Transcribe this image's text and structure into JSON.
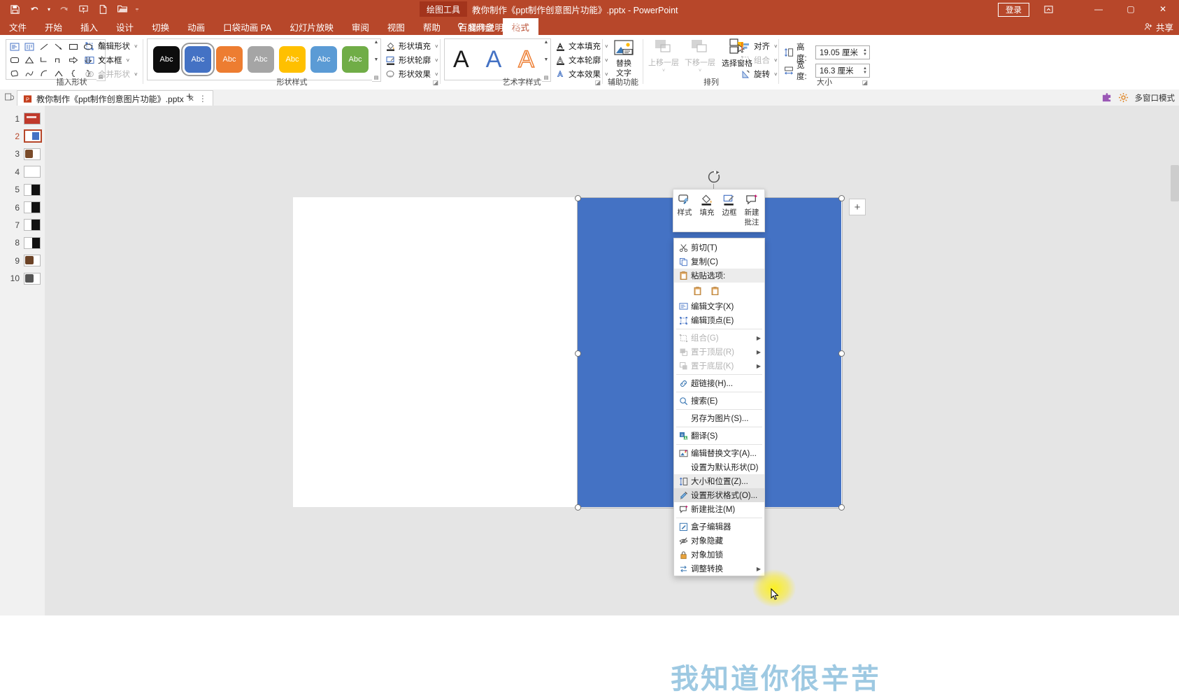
{
  "titlebar": {
    "context_tool": "绘图工具",
    "document_title": "教你制作《ppt制作创意图片功能》.pptx  -  PowerPoint",
    "signin": "登录",
    "minimize": "—",
    "maximize": "▢",
    "close": "✕",
    "qat": [
      "save-icon",
      "undo-icon",
      "redo-icon",
      "present-icon",
      "new-icon",
      "open-icon",
      "customize-qat-icon"
    ]
  },
  "tabs": {
    "items": [
      {
        "label": "文件",
        "active": false
      },
      {
        "label": "开始",
        "active": false
      },
      {
        "label": "插入",
        "active": false
      },
      {
        "label": "设计",
        "active": false
      },
      {
        "label": "切换",
        "active": false
      },
      {
        "label": "动画",
        "active": false
      },
      {
        "label": "口袋动画 PA",
        "active": false
      },
      {
        "label": "幻灯片放映",
        "active": false
      },
      {
        "label": "审阅",
        "active": false
      },
      {
        "label": "视图",
        "active": false
      },
      {
        "label": "帮助",
        "active": false
      },
      {
        "label": "百度网盘",
        "active": false
      },
      {
        "label": "格式",
        "active": true
      }
    ],
    "tellme": "操作说明搜索",
    "share": "共享"
  },
  "ribbon": {
    "groups": [
      {
        "label": "插入形状"
      },
      {
        "label": "形状样式"
      },
      {
        "label": "艺术字样式"
      },
      {
        "label": "辅助功能"
      },
      {
        "label": "排列"
      },
      {
        "label": "大小"
      }
    ],
    "shape_tools": [
      {
        "label": "编辑形状",
        "icon": "edit-shape-icon",
        "disabled": false,
        "caret": true
      },
      {
        "label": "文本框",
        "icon": "textbox-icon",
        "disabled": false,
        "caret": true
      },
      {
        "label": "合并形状",
        "icon": "merge-shapes-icon",
        "disabled": true,
        "caret": true
      }
    ],
    "shape_style_swatches": [
      {
        "color": "#0d0d0d",
        "label": "Abc",
        "selected": false
      },
      {
        "color": "#4472c4",
        "label": "Abc",
        "selected": true
      },
      {
        "color": "#ed7d31",
        "label": "Abc",
        "selected": false
      },
      {
        "color": "#a5a5a5",
        "label": "Abc",
        "selected": false
      },
      {
        "color": "#ffc000",
        "label": "Abc",
        "selected": false
      },
      {
        "color": "#5b9bd5",
        "label": "Abc",
        "selected": false
      },
      {
        "color": "#70ad47",
        "label": "Abc",
        "selected": false
      }
    ],
    "shape_format": [
      {
        "label": "形状填充",
        "icon": "shape-fill-icon"
      },
      {
        "label": "形状轮廓",
        "icon": "shape-outline-icon"
      },
      {
        "label": "形状效果",
        "icon": "shape-effects-icon"
      }
    ],
    "wordart_letters": [
      {
        "glyph": "A",
        "color": "#1a1a1a"
      },
      {
        "glyph": "A",
        "color": "#4472c4"
      },
      {
        "glyph": "A",
        "color": "#ed7d31"
      }
    ],
    "text_format": [
      {
        "label": "文本填充",
        "icon": "text-fill-icon"
      },
      {
        "label": "文本轮廓",
        "icon": "text-outline-icon"
      },
      {
        "label": "文本效果",
        "icon": "text-effects-icon"
      }
    ],
    "alt_text": "替换\n文字",
    "alt_text_line1": "替换",
    "alt_text_line2": "文字",
    "arrange": [
      {
        "label": "上移一层",
        "disabled": true,
        "caret": true
      },
      {
        "label": "下移一层",
        "disabled": true,
        "caret": true
      },
      {
        "label": "选择窗格",
        "disabled": false,
        "caret": false
      }
    ],
    "arrange_right": [
      {
        "label": "对齐",
        "icon": "align-icon",
        "disabled": false
      },
      {
        "label": "组合",
        "icon": "group-icon",
        "disabled": true
      },
      {
        "label": "旋转",
        "icon": "rotate-icon",
        "disabled": false
      }
    ],
    "size": {
      "height_label": "高度:",
      "height_value": "19.05 厘米",
      "width_label": "宽度:",
      "width_value": "16.3 厘米"
    }
  },
  "docbar": {
    "tab_title": "教你制作《ppt制作创意图片功能》.pptx",
    "tab_close": "✕",
    "tab_more": "⋮",
    "new_tab": "+",
    "multi_window": "多窗口模式"
  },
  "slides": {
    "items": [
      {
        "num": "1",
        "selected": false
      },
      {
        "num": "2",
        "selected": true
      },
      {
        "num": "3",
        "selected": false
      },
      {
        "num": "4",
        "selected": false
      },
      {
        "num": "5",
        "selected": false
      },
      {
        "num": "6",
        "selected": false
      },
      {
        "num": "7",
        "selected": false
      },
      {
        "num": "8",
        "selected": false
      },
      {
        "num": "9",
        "selected": false
      },
      {
        "num": "10",
        "selected": false
      }
    ]
  },
  "canvas": {
    "shape_color": "#4472c4",
    "bottom_text": "我知道你很辛苦",
    "add_button": "+"
  },
  "minibar": {
    "items": [
      {
        "label": "样式",
        "icon": "shape-style-icon",
        "caret": true
      },
      {
        "label": "填充",
        "icon": "fill-bucket-icon",
        "caret": true
      },
      {
        "label": "边框",
        "icon": "border-pen-icon",
        "caret": true
      },
      {
        "label": "新建\n批注",
        "line1": "新建",
        "line2": "批注",
        "icon": "new-comment-icon",
        "caret": false
      }
    ]
  },
  "context_menu": {
    "items": [
      {
        "label": "剪切(T)",
        "icon": "scissors-icon",
        "disabled": false,
        "arrow": false,
        "separator_after": false
      },
      {
        "label": "复制(C)",
        "icon": "copy-icon",
        "disabled": false,
        "arrow": false,
        "separator_after": false
      },
      {
        "label": "粘贴选项:",
        "icon": "paste-icon",
        "disabled": false,
        "arrow": false,
        "shaded": true,
        "separator_after": false
      },
      {
        "label": "编辑文字(X)",
        "icon": "edit-text-icon",
        "disabled": false,
        "arrow": false,
        "separator_after": false
      },
      {
        "label": "编辑顶点(E)",
        "icon": "edit-points-icon",
        "disabled": false,
        "arrow": false,
        "separator_after": true
      },
      {
        "label": "组合(G)",
        "icon": "group-icon",
        "disabled": true,
        "arrow": true,
        "separator_after": false
      },
      {
        "label": "置于顶层(R)",
        "icon": "bring-front-icon",
        "disabled": true,
        "arrow": true,
        "separator_after": false
      },
      {
        "label": "置于底层(K)",
        "icon": "send-back-icon",
        "disabled": true,
        "arrow": true,
        "separator_after": true
      },
      {
        "label": "超链接(H)...",
        "icon": "hyperlink-icon",
        "disabled": false,
        "arrow": false,
        "separator_after": true
      },
      {
        "label": "搜索(E)",
        "icon": "search-icon",
        "disabled": false,
        "arrow": false,
        "separator_after": true
      },
      {
        "label": "另存为图片(S)...",
        "icon": "",
        "disabled": false,
        "arrow": false,
        "separator_after": true
      },
      {
        "label": "翻译(S)",
        "icon": "translate-icon",
        "disabled": false,
        "arrow": false,
        "separator_after": true
      },
      {
        "label": "编辑替换文字(A)...",
        "icon": "alt-text-icon",
        "disabled": false,
        "arrow": false,
        "separator_after": false
      },
      {
        "label": "设置为默认形状(D)",
        "icon": "",
        "disabled": false,
        "arrow": false,
        "separator_after": false
      },
      {
        "label": "大小和位置(Z)...",
        "icon": "size-position-icon",
        "disabled": false,
        "arrow": false,
        "shaded": true,
        "separator_after": false
      },
      {
        "label": "设置形状格式(O)...",
        "icon": "format-shape-icon",
        "disabled": false,
        "arrow": false,
        "highlight": true,
        "separator_after": false
      },
      {
        "label": "新建批注(M)",
        "icon": "new-comment-icon",
        "disabled": false,
        "arrow": false,
        "separator_after": true
      },
      {
        "label": "盒子编辑器",
        "icon": "box-editor-icon",
        "disabled": false,
        "arrow": false,
        "separator_after": false
      },
      {
        "label": "对象隐藏",
        "icon": "hide-object-icon",
        "disabled": false,
        "arrow": false,
        "separator_after": false
      },
      {
        "label": "对象加锁",
        "icon": "lock-object-icon",
        "disabled": false,
        "arrow": false,
        "separator_after": false
      },
      {
        "label": "调整转换",
        "icon": "adjust-convert-icon",
        "disabled": false,
        "arrow": true,
        "separator_after": false
      }
    ]
  }
}
